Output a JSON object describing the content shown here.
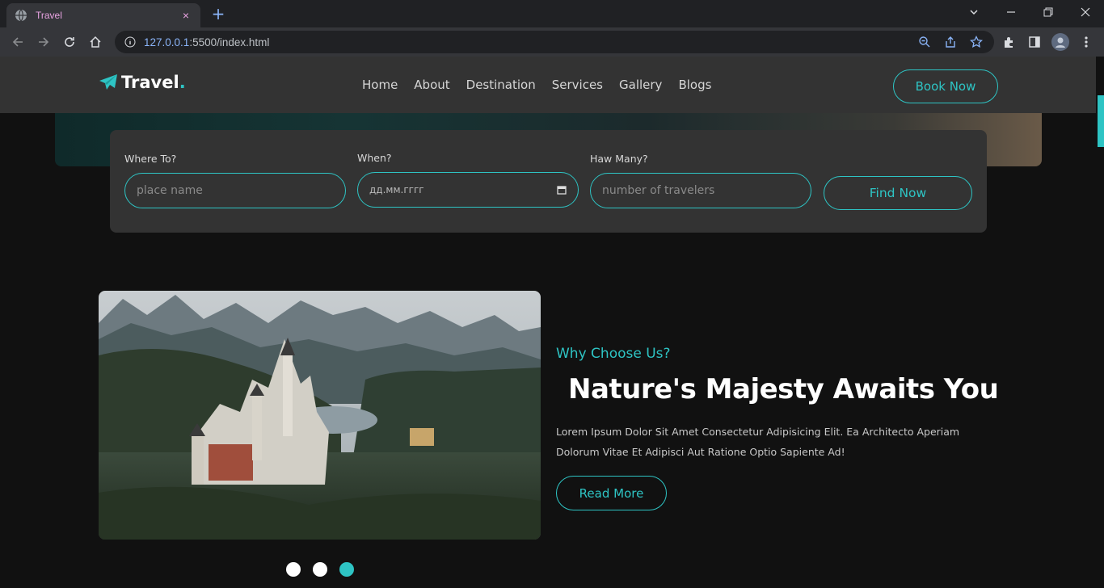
{
  "browser": {
    "tab_title": "Travel",
    "tab_close": "×",
    "new_tab": "+",
    "url_host": "127.0.0.1",
    "url_path": ":5500/index.html",
    "icons": [
      "back-icon",
      "forward-icon",
      "reload-icon",
      "home-icon",
      "info-icon",
      "zoom-icon",
      "share-icon",
      "star-icon",
      "extensions-icon",
      "sidepanel-icon",
      "profile-icon",
      "menu-icon"
    ]
  },
  "site": {
    "logo_text": "Travel",
    "logo_dot": ".",
    "nav": [
      "Home",
      "About",
      "Destination",
      "Services",
      "Gallery",
      "Blogs"
    ],
    "book_now": "Book Now"
  },
  "search": {
    "where_label": "Where To?",
    "where_placeholder": "place name",
    "when_label": "When?",
    "when_placeholder": "дд.мм.гггг",
    "many_label": "Haw Many?",
    "many_placeholder": "number of travelers",
    "find_button": "Find Now"
  },
  "about": {
    "eyebrow": "Why Choose Us?",
    "headline": "Nature's Majesty Awaits You",
    "body": "Lorem Ipsum Dolor Sit Amet Consectetur Adipisicing Elit. Ea Architecto Aperiam Dolorum Vitae Et Adipisci Aut Ratione Optio Sapiente Ad!",
    "read_more": "Read More"
  },
  "slider": {
    "count": 3,
    "active": 3
  },
  "colors": {
    "accent": "#2ec4c4",
    "header_bg": "#333333",
    "page_bg": "#111111"
  }
}
